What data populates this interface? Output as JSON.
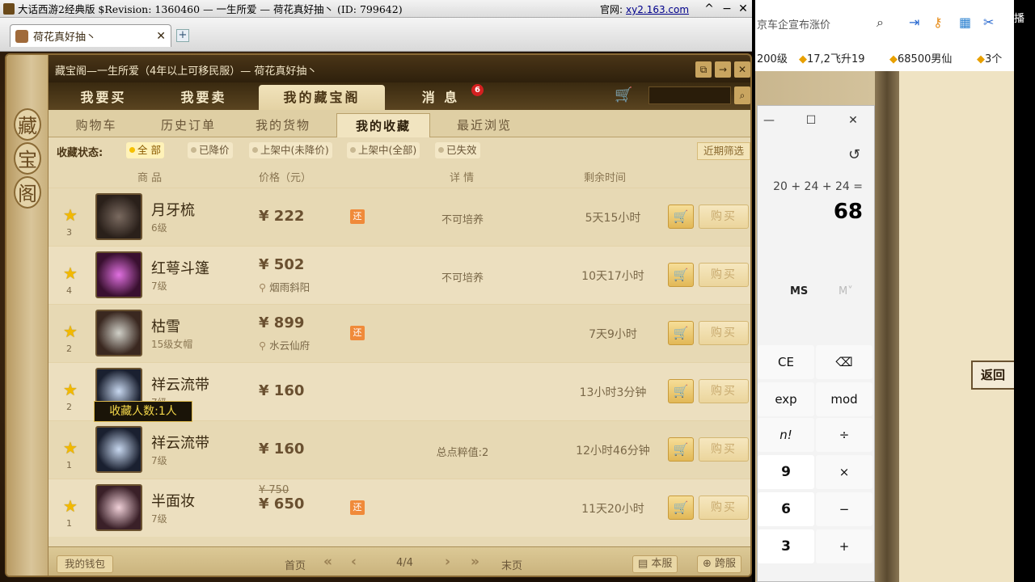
{
  "window": {
    "title": "大话西游2经典版 $Revision: 1360460 — 一生所爱 — 荷花真好抽丶 (ID: 799642)",
    "site_label": "官网:",
    "site_url": "xy2.163.com",
    "min": "^",
    "restore": "−",
    "close": "✕"
  },
  "browser_tab": {
    "label": "荷花真好抽丶",
    "close": "✕",
    "new_tab": "+"
  },
  "panel": {
    "title": "藏宝阁—一生所爱（4年以上可移民服）— 荷花真好抽丶",
    "side_seals": [
      "藏",
      "宝",
      "阁"
    ],
    "head_buttons": [
      "⧉",
      "→",
      "✕"
    ]
  },
  "main_tabs": [
    {
      "label": "我要买"
    },
    {
      "label": "我要卖"
    },
    {
      "label": "我的藏宝阁"
    },
    {
      "label": "消 息",
      "badge": "6"
    }
  ],
  "sub_tabs": [
    "购物车",
    "历史订单",
    "我的货物",
    "我的收藏",
    "最近浏览"
  ],
  "filter": {
    "label": "收藏状态:",
    "options": [
      "全 部",
      "已降价",
      "上架中(未降价)",
      "上架中(全部)",
      "已失效"
    ],
    "recent": "近期筛选"
  },
  "columns": {
    "item": "商 品",
    "price": "价格（元）",
    "detail": "详 情",
    "remain": "剩余时间"
  },
  "rows": [
    {
      "count": "3",
      "name": "月牙梳",
      "level": "6级",
      "price": "¥ 222",
      "huan": "还",
      "detail": "不可培养",
      "remain": "5天15小时"
    },
    {
      "count": "4",
      "name": "红萼斗篷",
      "level": "7级",
      "price": "¥ 502",
      "loc": "烟雨斜阳",
      "detail": "不可培养",
      "remain": "10天17小时"
    },
    {
      "count": "2",
      "name": "枯雪",
      "level": "15级女帽",
      "price": "¥ 899",
      "loc": "水云仙府",
      "huan": "还",
      "remain": "7天9小时"
    },
    {
      "count": "2",
      "name": "祥云流带",
      "level": "7级",
      "price": "¥ 160",
      "remain": "13小时3分钟"
    },
    {
      "count": "1",
      "name": "祥云流带",
      "level": "7级",
      "price": "¥ 160",
      "detail": "总点粹值:2",
      "remain": "12小时46分钟"
    },
    {
      "count": "1",
      "name": "半面妆",
      "level": "7级",
      "price_old": "¥ 750",
      "price": "¥ 650",
      "huan": "还",
      "remain": "11天20小时"
    }
  ],
  "buy_label": "购买",
  "tooltip": "收藏人数:1人",
  "footer": {
    "wallet": "我的钱包",
    "first": "首页",
    "page": "4/4",
    "last": "末页",
    "this_server": "本服",
    "cross_server": "跨服"
  },
  "browser_side": {
    "search_text": "京车企宣布涨价",
    "hot": [
      "200级",
      "17,2飞升19",
      "68500男仙",
      "3个"
    ]
  },
  "calculator": {
    "history_icon": "↺",
    "expression": "20 + 24 + 24 =",
    "result": "68",
    "ms": "MS",
    "mplus": "M˅",
    "keys": [
      "CE",
      "⌫",
      "exp",
      "mod",
      "n!",
      "÷",
      "9",
      "×",
      "6",
      "−",
      "3",
      "+"
    ]
  },
  "back_button": "返回",
  "live_label": "播"
}
